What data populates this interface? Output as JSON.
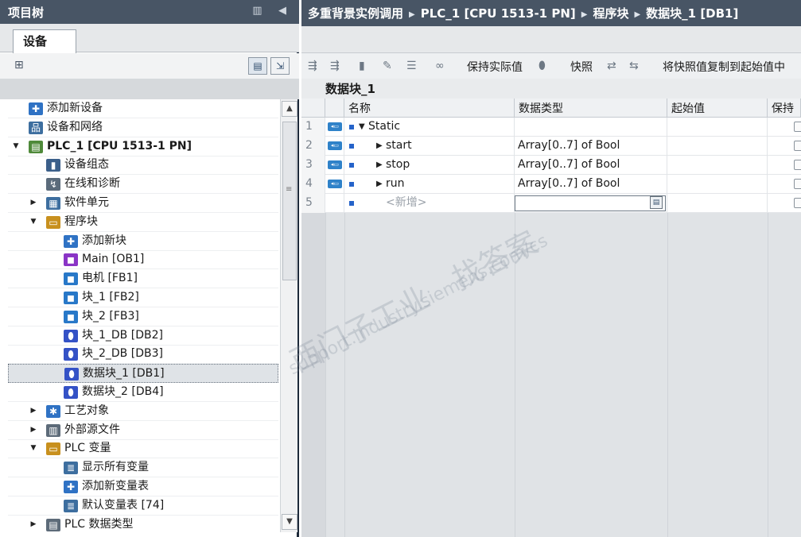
{
  "left_panel": {
    "title": "项目树",
    "title_controls": "▥ ◀",
    "tab": "设备",
    "tree": [
      {
        "label": "添加新设备",
        "indent": 1,
        "icon": "add-device-icon",
        "glyph": "✚",
        "color": "#2f72c4",
        "arrow": ""
      },
      {
        "label": "设备和网络",
        "indent": 1,
        "icon": "network-icon",
        "glyph": "品",
        "color": "#3d6e9f",
        "arrow": ""
      },
      {
        "label": "PLC_1 [CPU 1513-1 PN]",
        "indent": 1,
        "icon": "plc-icon",
        "glyph": "▤",
        "color": "#4f8a3a",
        "arrow": "▼",
        "bold": true
      },
      {
        "label": "设备组态",
        "indent": 2,
        "icon": "device-config-icon",
        "glyph": "▮",
        "color": "#3b5f8a",
        "arrow": ""
      },
      {
        "label": "在线和诊断",
        "indent": 2,
        "icon": "online-diagnostics-icon",
        "glyph": "↯",
        "color": "#5b6b7b",
        "arrow": ""
      },
      {
        "label": "软件单元",
        "indent": 2,
        "icon": "software-unit-icon",
        "glyph": "▦",
        "color": "#3d6e9f",
        "arrow": "▶"
      },
      {
        "label": "程序块",
        "indent": 2,
        "icon": "program-blocks-folder-icon",
        "glyph": "▭",
        "color": "#c8901e",
        "arrow": "▼"
      },
      {
        "label": "添加新块",
        "indent": 3,
        "icon": "add-block-icon",
        "glyph": "✚",
        "color": "#2f72c4",
        "arrow": ""
      },
      {
        "label": "Main [OB1]",
        "indent": 3,
        "icon": "ob-block-icon",
        "glyph": "◼",
        "color": "#8a34c6",
        "arrow": ""
      },
      {
        "label": "电机 [FB1]",
        "indent": 3,
        "icon": "fb-block-icon",
        "glyph": "◼",
        "color": "#2878c8",
        "arrow": ""
      },
      {
        "label": "块_1 [FB2]",
        "indent": 3,
        "icon": "fb-block-icon",
        "glyph": "◼",
        "color": "#2878c8",
        "arrow": ""
      },
      {
        "label": "块_2 [FB3]",
        "indent": 3,
        "icon": "fb-block-icon",
        "glyph": "◼",
        "color": "#2878c8",
        "arrow": ""
      },
      {
        "label": "块_1_DB [DB2]",
        "indent": 3,
        "icon": "db-block-icon",
        "glyph": "⬮",
        "color": "#3452c6",
        "arrow": ""
      },
      {
        "label": "块_2_DB [DB3]",
        "indent": 3,
        "icon": "db-block-icon",
        "glyph": "⬮",
        "color": "#3452c6",
        "arrow": ""
      },
      {
        "label": "数据块_1 [DB1]",
        "indent": 3,
        "icon": "db-block-icon",
        "glyph": "⬮",
        "color": "#3452c6",
        "arrow": "",
        "selected": true
      },
      {
        "label": "数据块_2 [DB4]",
        "indent": 3,
        "icon": "db-block-icon",
        "glyph": "⬮",
        "color": "#3452c6",
        "arrow": ""
      },
      {
        "label": "工艺对象",
        "indent": 2,
        "icon": "technology-objects-icon",
        "glyph": "✱",
        "color": "#2f72c4",
        "arrow": "▶"
      },
      {
        "label": "外部源文件",
        "indent": 2,
        "icon": "external-source-files-icon",
        "glyph": "▥",
        "color": "#5d6b79",
        "arrow": "▶"
      },
      {
        "label": "PLC 变量",
        "indent": 2,
        "icon": "plc-tags-folder-icon",
        "glyph": "▭",
        "color": "#c8901e",
        "arrow": "▼"
      },
      {
        "label": "显示所有变量",
        "indent": 3,
        "icon": "show-all-tags-icon",
        "glyph": "≣",
        "color": "#3d6e9f",
        "arrow": ""
      },
      {
        "label": "添加新变量表",
        "indent": 3,
        "icon": "add-tag-table-icon",
        "glyph": "✚",
        "color": "#2f72c4",
        "arrow": ""
      },
      {
        "label": "默认变量表 [74]",
        "indent": 3,
        "icon": "default-tag-table-icon",
        "glyph": "≣",
        "color": "#3d6e9f",
        "arrow": ""
      },
      {
        "label": "PLC 数据类型",
        "indent": 2,
        "icon": "plc-data-types-icon",
        "glyph": "▤",
        "color": "#5d6b79",
        "arrow": "▶"
      }
    ]
  },
  "right_panel": {
    "breadcrumb": [
      "多重背景实例调用",
      "PLC_1 [CPU 1513-1 PN]",
      "程序块",
      "数据块_1 [DB1]"
    ],
    "toolbar": {
      "keep_actual_values": "保持实际值",
      "snapshot": "快照",
      "copy_snapshot": "将快照值复制到起始值中"
    },
    "block_title": "数据块_1",
    "columns": [
      "名称",
      "数据类型",
      "起始值",
      "保持"
    ],
    "rows": [
      {
        "num": "1",
        "name": "Static",
        "type": "",
        "expand": "▼",
        "indent": 0,
        "badge": true
      },
      {
        "num": "2",
        "name": "start",
        "type": "Array[0..7] of Bool",
        "expand": "▶",
        "indent": 1,
        "badge": true
      },
      {
        "num": "3",
        "name": "stop",
        "type": "Array[0..7] of Bool",
        "expand": "▶",
        "indent": 1,
        "badge": true
      },
      {
        "num": "4",
        "name": "run",
        "type": "Array[0..7] of Bool",
        "expand": "▶",
        "indent": 1,
        "badge": true
      },
      {
        "num": "5",
        "name": "<新增>",
        "type": "",
        "expand": "",
        "indent": 1,
        "badge": false,
        "placeholder": true
      }
    ]
  },
  "watermark": {
    "cn": "西门子工业　找答案",
    "en": "support.industry.siemens.com/cs"
  }
}
